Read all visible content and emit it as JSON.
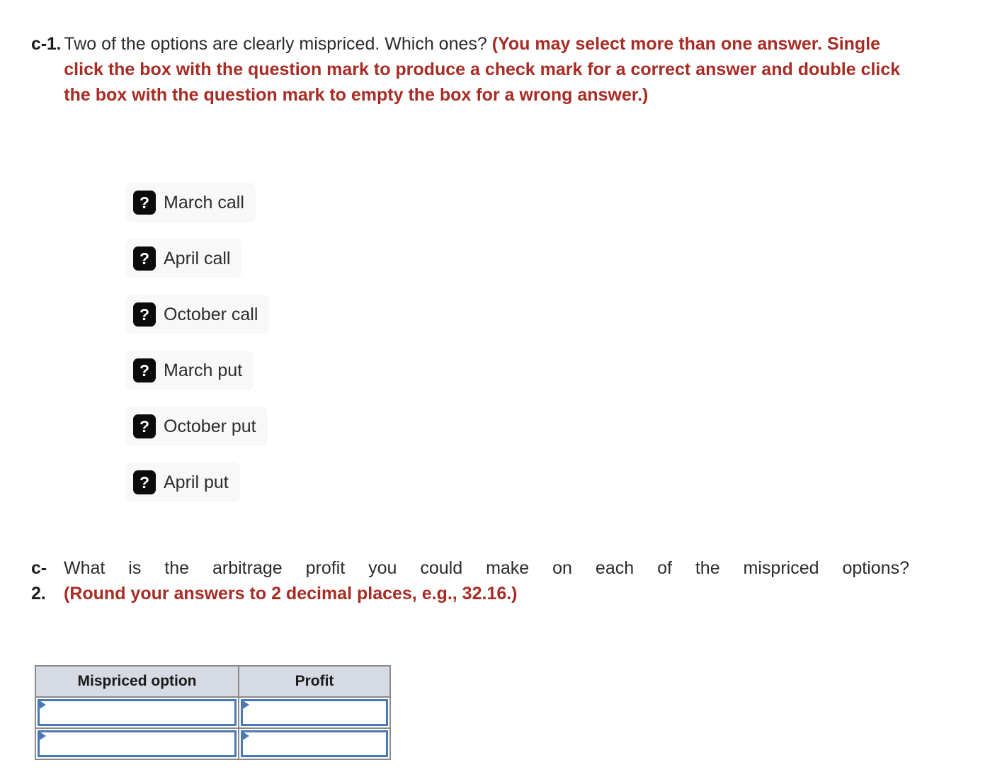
{
  "questions": {
    "c1": {
      "label": "c-1.",
      "text_plain": "Two of the options are clearly mispriced. Which ones? ",
      "text_emphasis": "(You may select more than one answer. Single click the box with the question mark to produce a check mark for a correct answer and double click the box with the question mark to empty the box for a wrong answer.)"
    },
    "c2": {
      "label_line1": "c-",
      "label_line2": "2.",
      "text_plain": "What is the arbitrage profit you could make on each of the mispriced options?",
      "text_emphasis": "(Round your answers to 2 decimal places, e.g., 32.16.)"
    }
  },
  "options": {
    "marker_glyph": "?",
    "items": [
      {
        "label": "March call"
      },
      {
        "label": "April call"
      },
      {
        "label": "October call"
      },
      {
        "label": "March put"
      },
      {
        "label": "October put"
      },
      {
        "label": "April put"
      }
    ]
  },
  "answer_table": {
    "headers": [
      "Mispriced option",
      "Profit"
    ],
    "rows": [
      {
        "mispriced_option": "",
        "profit": ""
      },
      {
        "mispriced_option": "",
        "profit": ""
      }
    ]
  },
  "colors": {
    "emphasis_red": "#a82b24",
    "body_text": "#2b2b2b",
    "pill_background": "#f8f8f8",
    "marker_box": "#0b0b0b",
    "table_header": "#d6dae3",
    "table_border": "#8a8a8a",
    "input_border": "#4a7ab5"
  }
}
